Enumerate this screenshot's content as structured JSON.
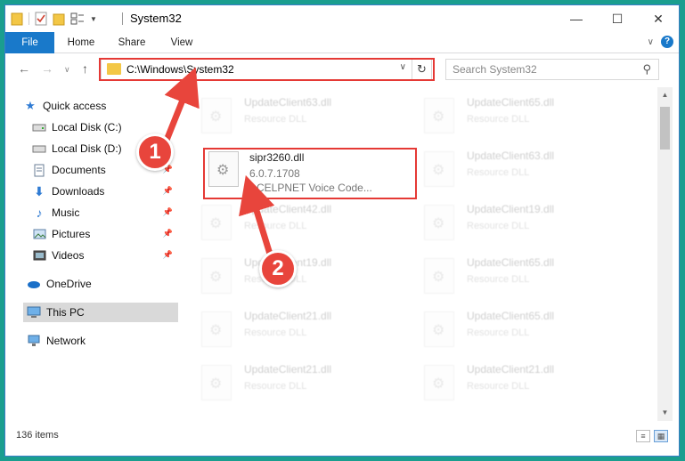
{
  "window": {
    "title": "System32"
  },
  "ribbon": {
    "tabs": [
      "File",
      "Home",
      "Share",
      "View"
    ]
  },
  "address": {
    "path": "C:\\Windows\\System32",
    "search_placeholder": "Search System32"
  },
  "navpane": {
    "items": [
      {
        "label": "Quick access",
        "icon": "star-icon"
      },
      {
        "label": "Local Disk (C:)",
        "icon": "drive-icon"
      },
      {
        "label": "Local Disk (D:)",
        "icon": "drive-icon"
      },
      {
        "label": "Documents",
        "icon": "documents-icon"
      },
      {
        "label": "Downloads",
        "icon": "download-icon"
      },
      {
        "label": "Music",
        "icon": "music-icon"
      },
      {
        "label": "Pictures",
        "icon": "pictures-icon"
      },
      {
        "label": "Videos",
        "icon": "videos-icon"
      },
      {
        "label": "OneDrive",
        "icon": "cloud-icon"
      },
      {
        "label": "This PC",
        "icon": "computer-icon"
      },
      {
        "label": "Network",
        "icon": "network-icon"
      }
    ]
  },
  "files": {
    "highlighted": {
      "name": "sipr3260.dll",
      "version": "6.0.7.1708",
      "description": "ACELPNET Voice Code..."
    },
    "left": [
      {
        "name": "UpdateClient63.dll",
        "type": "Resource DLL"
      },
      {
        "name": "UpdateClient42.dll",
        "type": "Resource DLL"
      },
      {
        "name": "UpdateClient19.dll",
        "type": "Resource DLL"
      },
      {
        "name": "UpdateClient21.dll",
        "type": "Resource DLL"
      },
      {
        "name": "UpdateClient21.dll",
        "type": "Resource DLL"
      }
    ],
    "right": [
      {
        "name": "UpdateClient65.dll",
        "type": "Resource DLL"
      },
      {
        "name": "UpdateClient63.dll",
        "type": "Resource DLL"
      },
      {
        "name": "UpdateClient19.dll",
        "type": "Resource DLL"
      },
      {
        "name": "UpdateClient65.dll",
        "type": "Resource DLL"
      },
      {
        "name": "UpdateClient65.dll",
        "type": "Resource DLL"
      },
      {
        "name": "UpdateClient21.dll",
        "type": "Resource DLL"
      }
    ]
  },
  "status": {
    "items_count": "136 items"
  },
  "annotations": {
    "step1": "1",
    "step2": "2"
  },
  "colors": {
    "accent": "#1979ca",
    "highlight": "#e53935",
    "badge": "#e8453c",
    "desktop": "#1a9e8f"
  }
}
